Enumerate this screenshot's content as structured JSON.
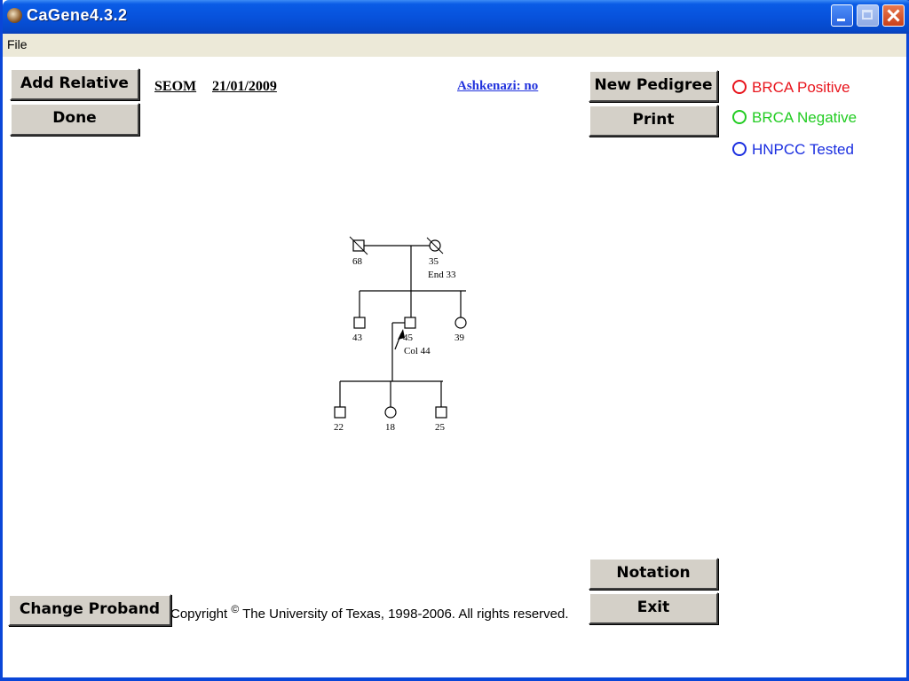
{
  "window": {
    "title": "CaGene4.3.2"
  },
  "menu": {
    "items": [
      "File"
    ]
  },
  "buttons": {
    "add_relative": "Add Relative",
    "done": "Done",
    "new_pedigree": "New Pedigree",
    "print": "Print",
    "notation": "Notation",
    "exit": "Exit",
    "change_proband": "Change Proband"
  },
  "header": {
    "center": "SEOM",
    "date": "21/01/2009",
    "ashkenazi": "Ashkenazi: no"
  },
  "legend": [
    {
      "label": "BRCA Positive",
      "color": "#e8141c"
    },
    {
      "label": "BRCA Negative",
      "color": "#22cc22"
    },
    {
      "label": "HNPCC Tested",
      "color": "#1a2ee0"
    }
  ],
  "pedigree": {
    "grandfather": {
      "age": "68",
      "sex": "male",
      "deceased": true
    },
    "grandmother": {
      "age": "35",
      "sex": "female",
      "deceased": true,
      "note": "End 33"
    },
    "uncle": {
      "age": "43",
      "sex": "male"
    },
    "proband": {
      "age": "45",
      "sex": "male",
      "note": "Col 44",
      "proband": true
    },
    "aunt": {
      "age": "39",
      "sex": "female"
    },
    "child1": {
      "age": "22",
      "sex": "male"
    },
    "child2": {
      "age": "18",
      "sex": "female"
    },
    "child3": {
      "age": "25",
      "sex": "male"
    }
  },
  "footer": {
    "copyright_prefix": "Copyright",
    "copyright_symbol": "©",
    "copyright_text": "The University of Texas, 1998-2006.  All rights reserved."
  }
}
